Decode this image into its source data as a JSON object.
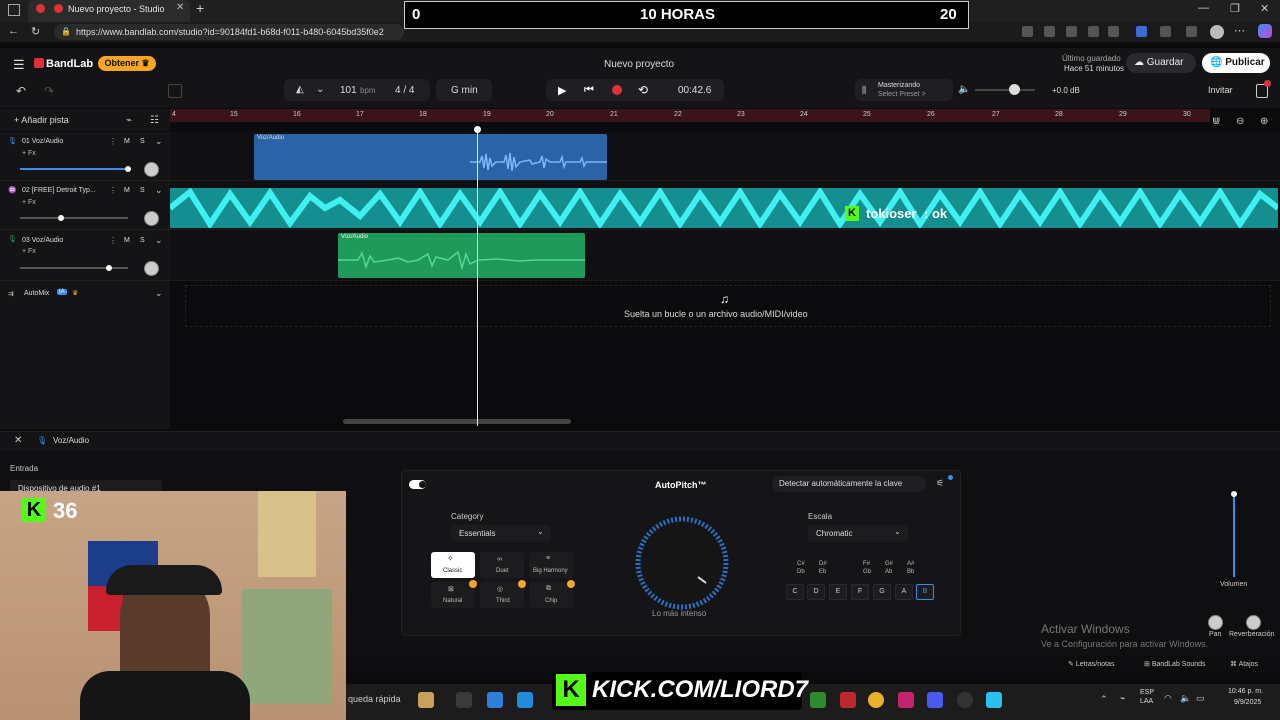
{
  "browser": {
    "tab_title": "Nuevo proyecto - Studio",
    "url": "https://www.bandlab.com/studio?id=90184fd1-b68d-f011-b480-6045bd35f0e2"
  },
  "overlay": {
    "timer_left": "0",
    "timer_center": "10 HORAS",
    "timer_right": "20",
    "chat_user": "tokioser",
    "chat_message": ": ok",
    "kick_count": "36",
    "kick_url": "KICK.COM/LIORD7"
  },
  "header": {
    "logo": "BandLab",
    "get_button": "Obtener",
    "project_title": "Nuevo proyecto",
    "saved_line1": "Último guardado",
    "saved_line2": "Hace 51 minutos",
    "save_button": "Guardar",
    "publish_button": "Publicar"
  },
  "toolbar": {
    "bpm": "101",
    "bpm_unit": "bpm",
    "time_sig": "4 / 4",
    "key": "G min",
    "time": "00:42.6",
    "mastering_title": "Masterizando",
    "mastering_sub": "Select Preset >",
    "volume_db": "+0.0 dB",
    "invite": "Invitar"
  },
  "ruler": {
    "ticks": [
      "4",
      "15",
      "16",
      "17",
      "18",
      "19",
      "20",
      "21",
      "22",
      "23",
      "24",
      "25",
      "26",
      "27",
      "28",
      "29",
      "30"
    ]
  },
  "tracks": [
    {
      "name": "01  Voz/Audio",
      "fx": "+ Fx",
      "m": "M",
      "s": "S",
      "clip_label": "Voz/Audio"
    },
    {
      "name": "02  [FREE] Detroit Typ...",
      "fx": "+ Fx",
      "m": "M",
      "s": "S"
    },
    {
      "name": "03  Voz/Audio",
      "fx": "+ Fx",
      "m": "M",
      "s": "S",
      "clip_label": "Voz/Audio"
    }
  ],
  "add_track": "Añadir pista",
  "automix": {
    "label": "AutoMix",
    "badge": "IA"
  },
  "drop_hint": "Suelta un bucle o un archivo audio/MIDI/video",
  "panel": {
    "track_name": "Voz/Audio",
    "input_label": "Entrada",
    "input_device": "Dispositivo de audio #1",
    "autopitch_title": "AutoPitch™",
    "detect_key": "Detectar automáticamente la clave",
    "category_label": "Category",
    "category_value": "Essentials",
    "effects": [
      "Classic",
      "Duet",
      "Big Harmony",
      "Natural",
      "Third",
      "Chip"
    ],
    "knob_label": "Lo más intenso",
    "scale_label": "Escala",
    "scale_value": "Chromatic",
    "sharps": [
      "C#\nDb",
      "D#\nEb",
      "F#\nGb",
      "G#\nAb",
      "A#\nBb"
    ],
    "naturals": [
      "C",
      "D",
      "E",
      "F",
      "G",
      "A",
      "B"
    ],
    "volume_label": "Volumen",
    "pan_label": "Pan",
    "reverb_label": "Reverberación",
    "activate_title": "Activar Windows",
    "activate_sub": "Ve a Configuración para activar Windows.",
    "lyrics_link": "Letras/notas",
    "sounds_link": "BandLab Sounds",
    "shortcuts_link": "Atajos"
  },
  "taskbar": {
    "search": "queda rápida",
    "lang": "ESP\nLAA",
    "time": "10:46 p. m.",
    "date": "9/9/2025"
  },
  "colors": {
    "accent_red": "#e0313b",
    "clip_blue": "#2b63a8",
    "clip_cyan": "#1ed6d6",
    "clip_green": "#1f9a5a",
    "kick_green": "#53fc18"
  }
}
